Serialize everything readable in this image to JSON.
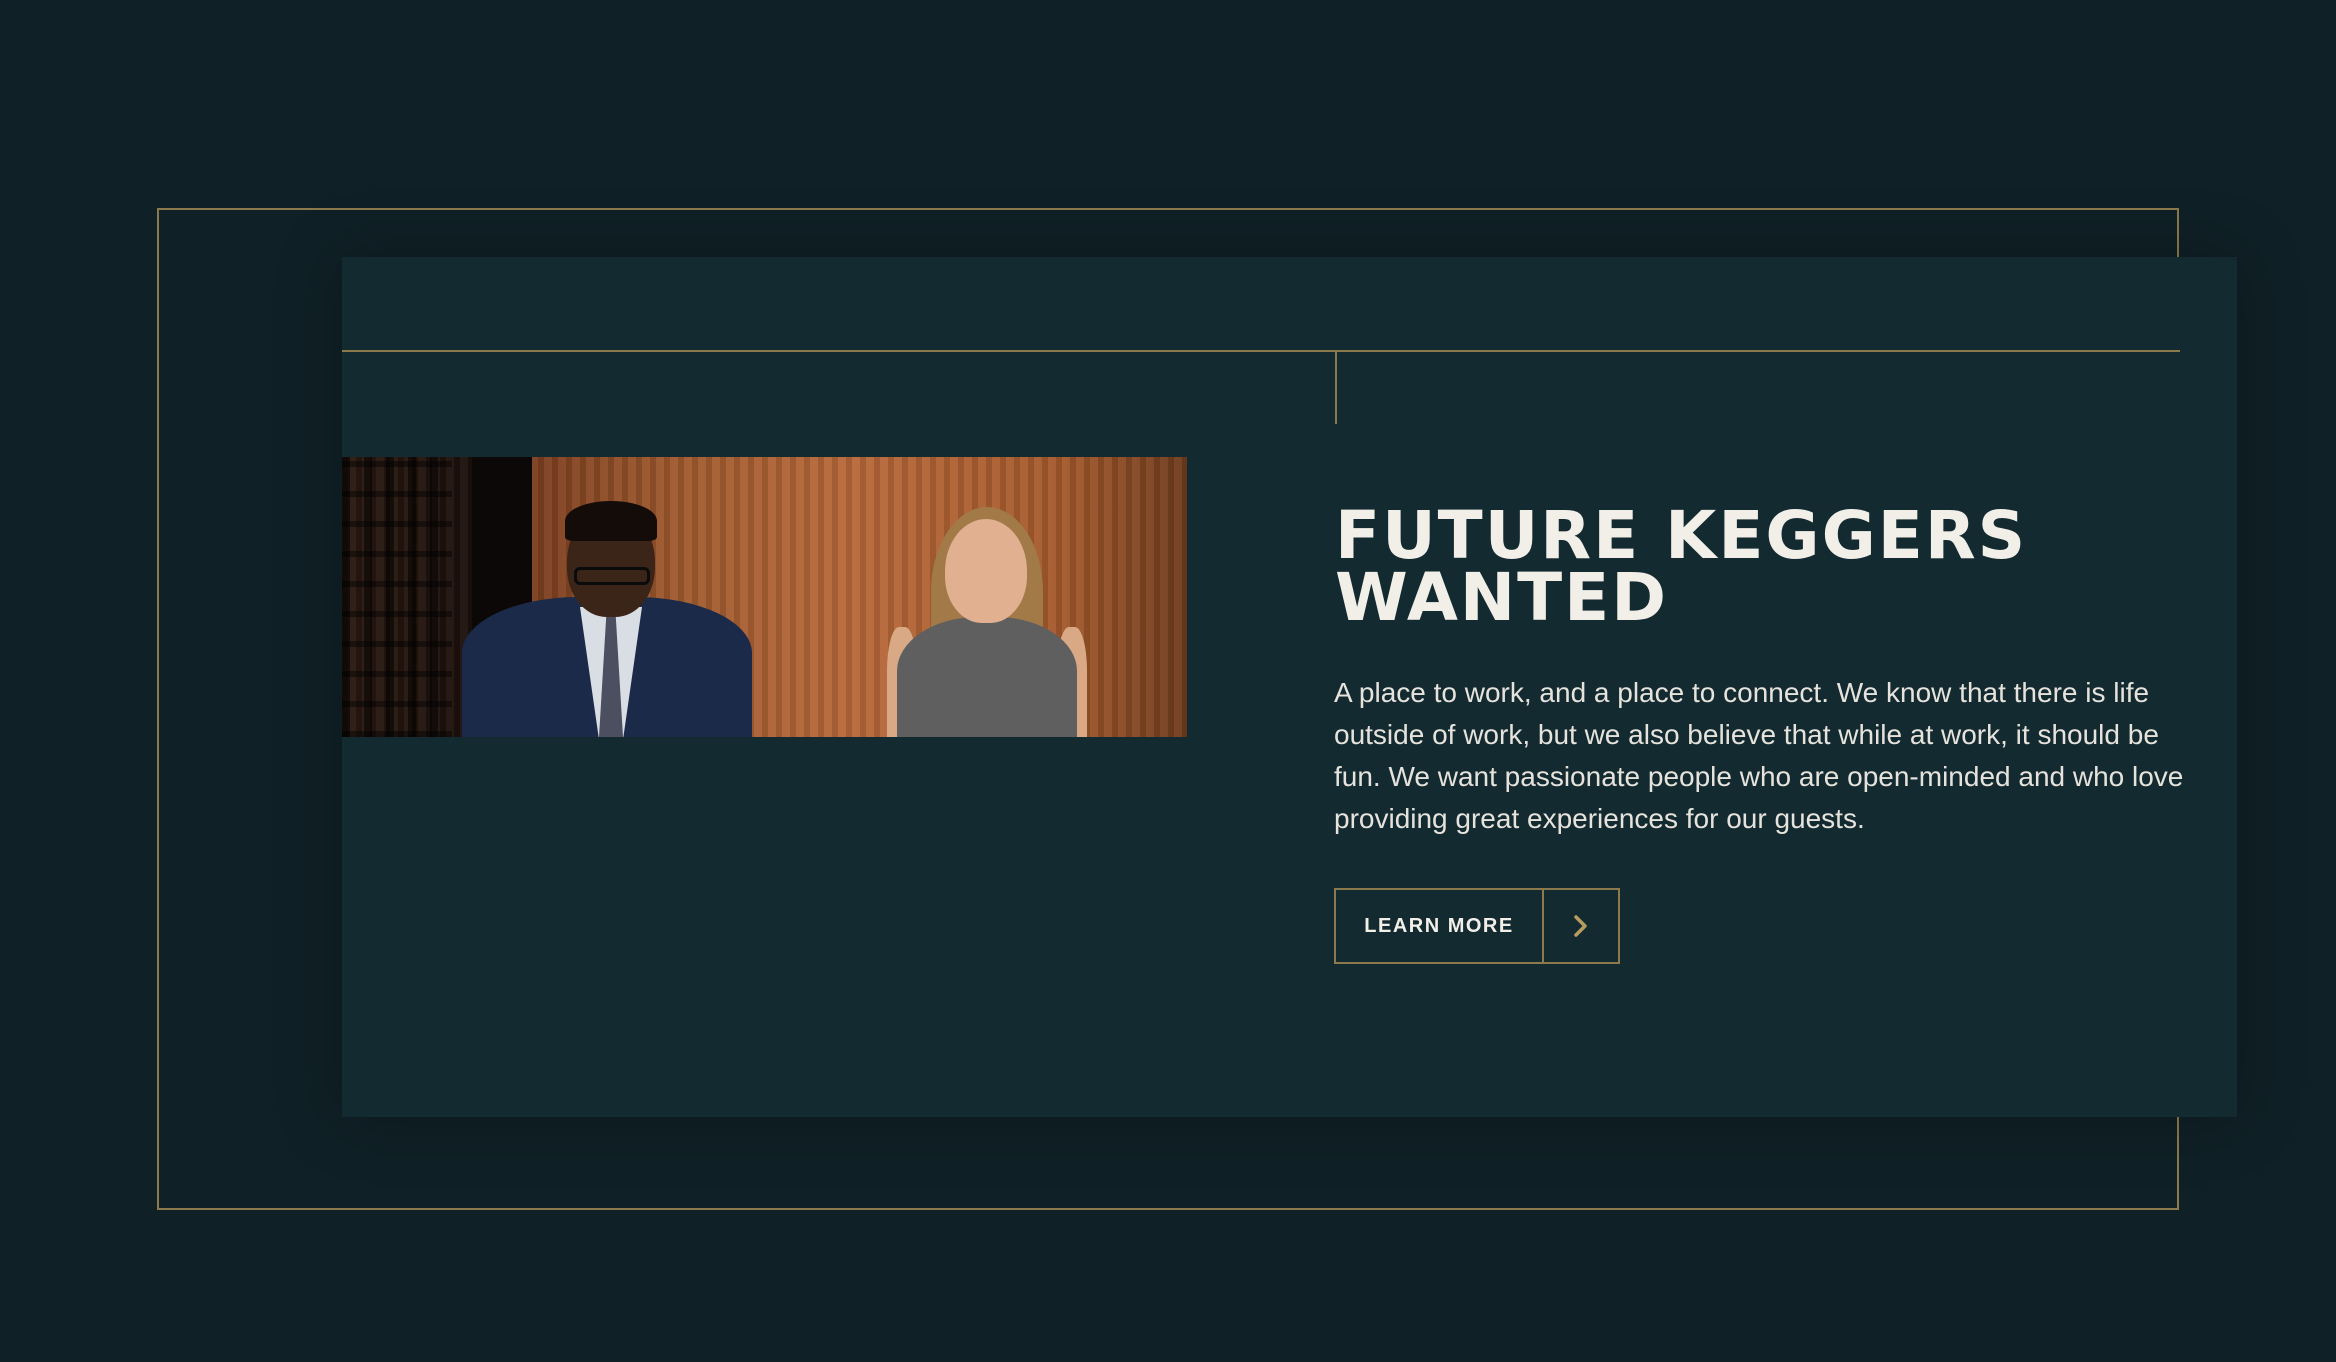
{
  "section": {
    "title": "FUTURE KEGGERS WANTED",
    "description": "A place to work, and a place to connect. We know that there is life outside of work, but we also believe that while at work, it should be fun. We want passionate people who are open-minded and who love providing great experiences for our guests.",
    "cta": {
      "label": "LEARN MORE",
      "icon": "chevron-right-icon"
    }
  },
  "colors": {
    "background": "#0f2026",
    "panel": "#132a31",
    "accent_gold": "#8c7a4c",
    "text": "#f2efe8"
  }
}
